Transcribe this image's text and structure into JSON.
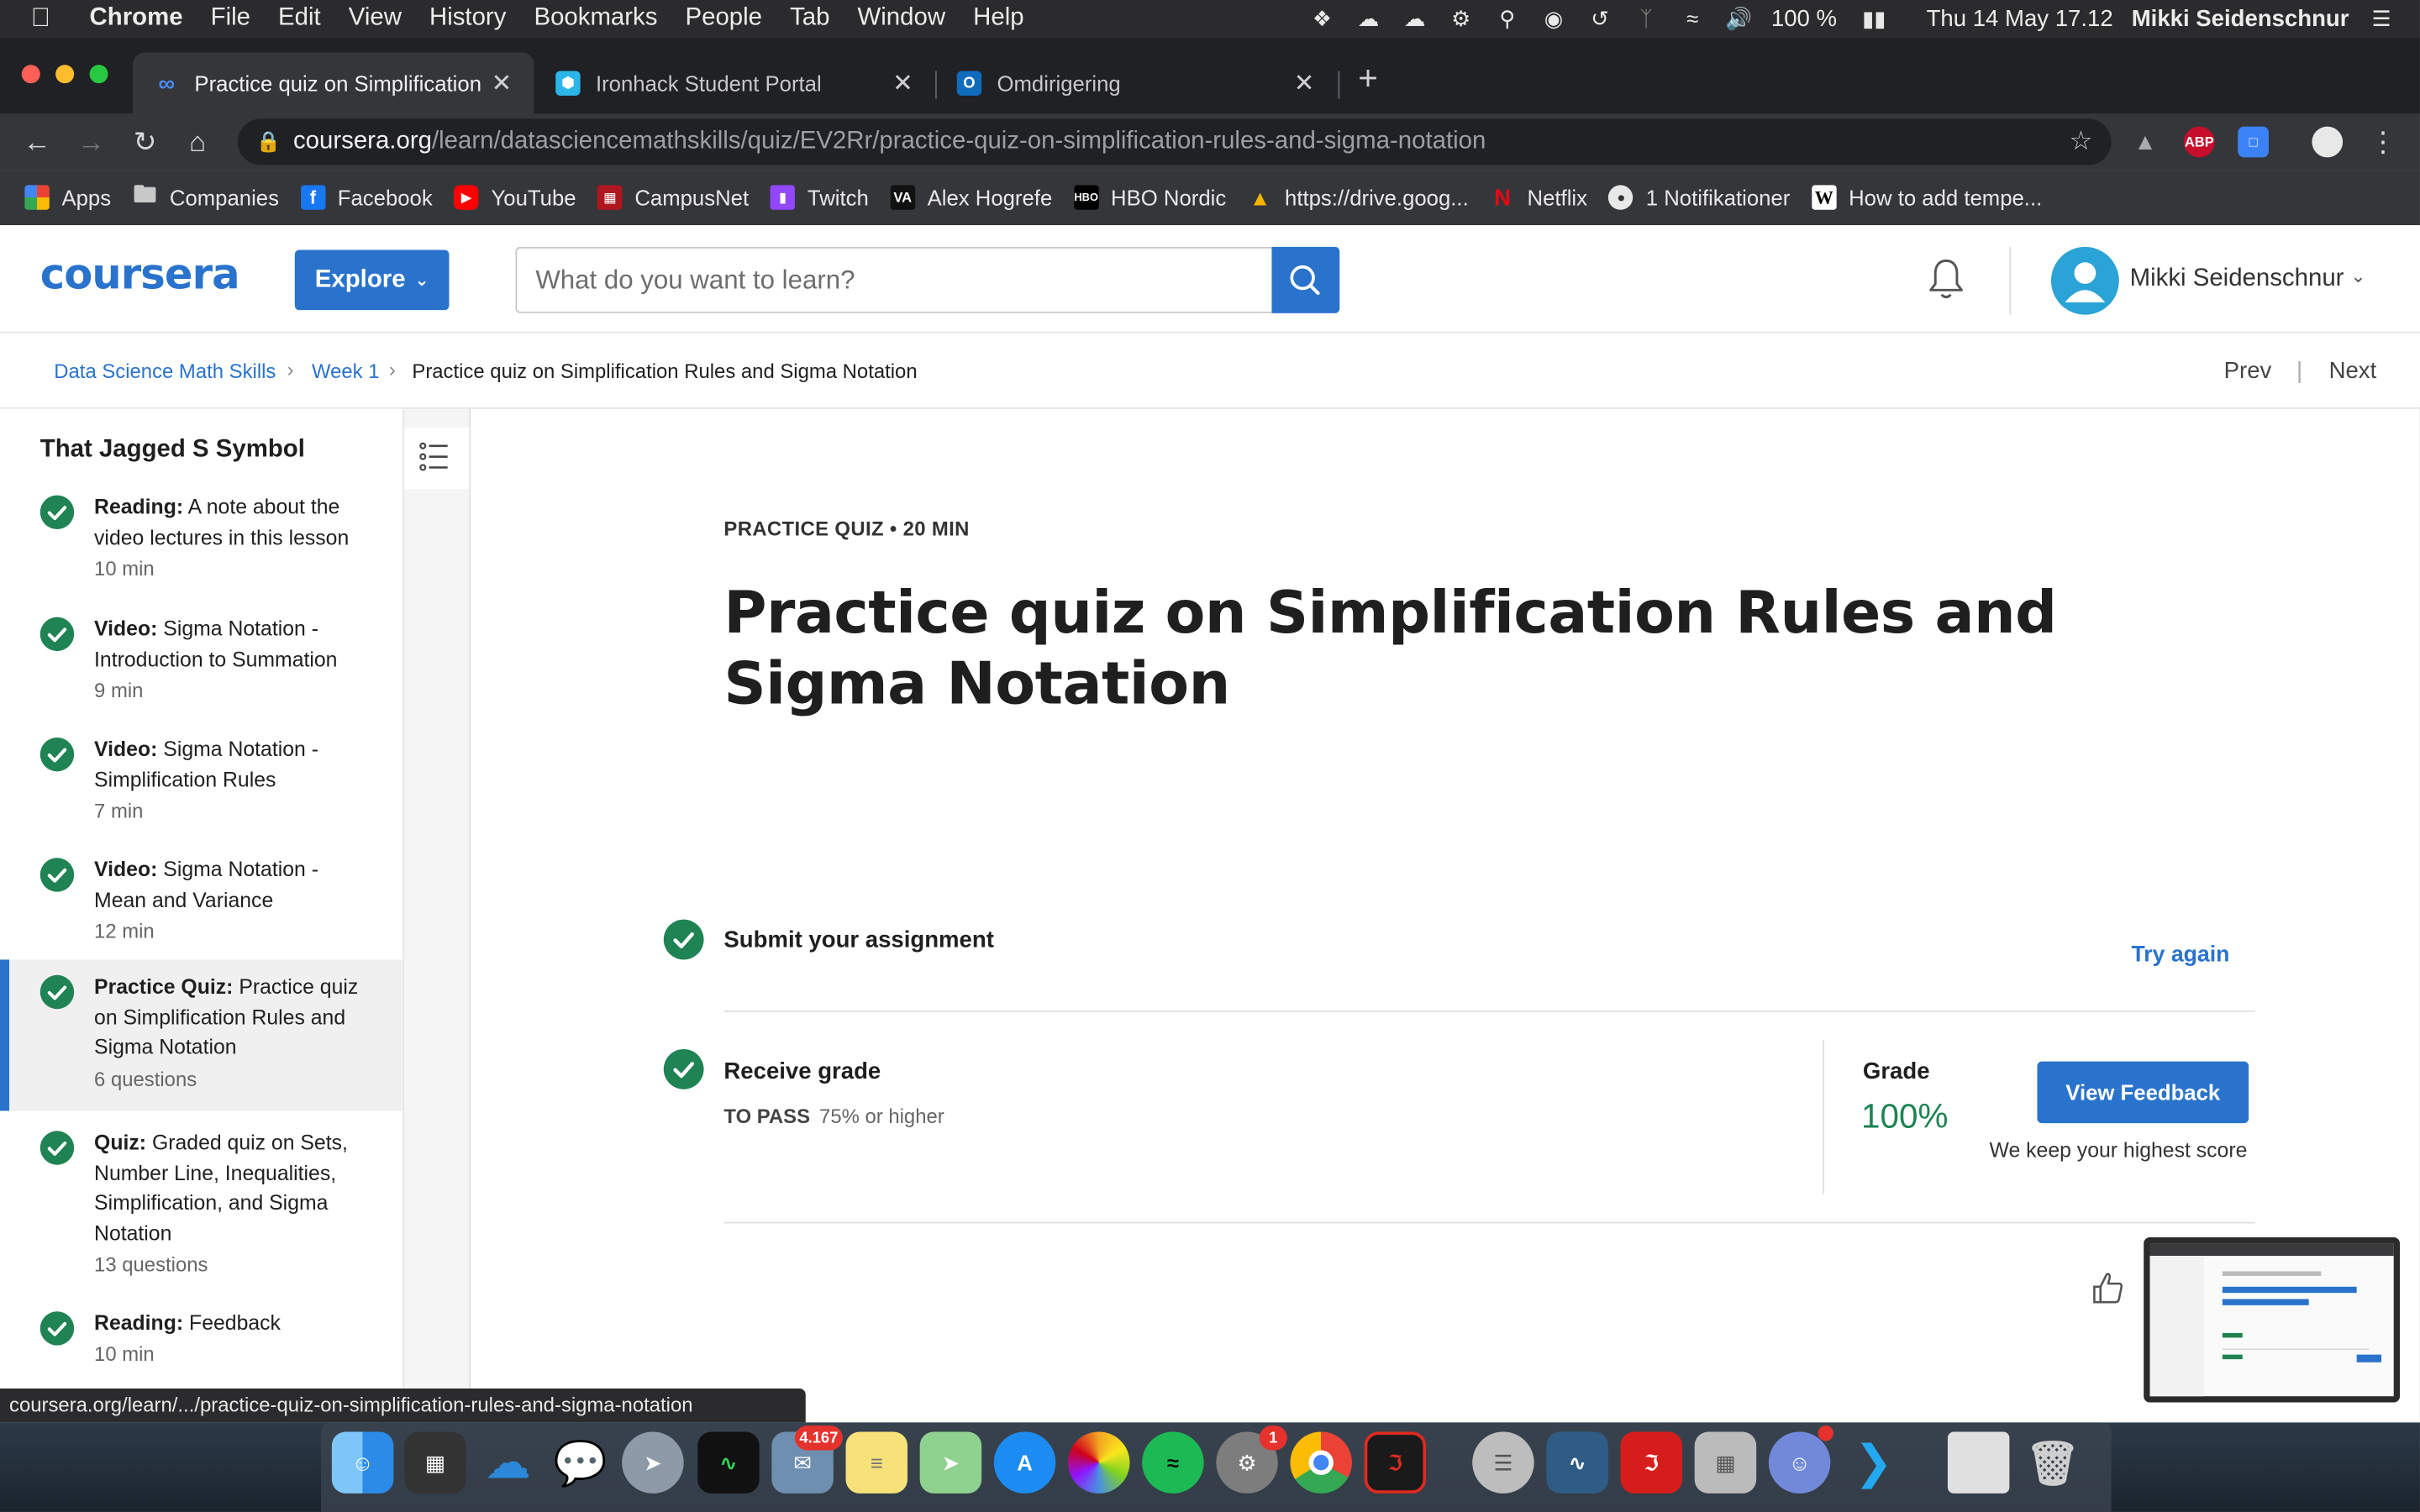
{
  "menubar": {
    "app_name": "Chrome",
    "items": [
      "File",
      "Edit",
      "View",
      "History",
      "Bookmarks",
      "People",
      "Tab",
      "Window",
      "Help"
    ],
    "battery": "100 %",
    "datetime": "Thu 14 May  17.12",
    "user": "Mikki Seidenschnur"
  },
  "tabs": [
    {
      "title": "Practice quiz on Simplification",
      "icon": "coursera-icon",
      "active": true
    },
    {
      "title": "Ironhack Student Portal",
      "icon": "ironhack-icon",
      "active": false
    },
    {
      "title": "Omdirigering",
      "icon": "outlook-icon",
      "active": false
    }
  ],
  "address_bar": {
    "host": "coursera.org",
    "path": "/learn/datasciencemathskills/quiz/EV2Rr/practice-quiz-on-simplification-rules-and-sigma-notation"
  },
  "bookmarks": [
    {
      "label": "Apps",
      "icon": "apps-grid-icon",
      "color": "#e8453c"
    },
    {
      "label": "Companies",
      "icon": "folder-icon",
      "color": "#9aa0a6"
    },
    {
      "label": "Facebook",
      "icon": "facebook-icon",
      "color": "#1877f2"
    },
    {
      "label": "YouTube",
      "icon": "youtube-icon",
      "color": "#ff0000"
    },
    {
      "label": "CampusNet",
      "icon": "campusnet-icon",
      "color": "#b0161e"
    },
    {
      "label": "Twitch",
      "icon": "twitch-icon",
      "color": "#9146ff"
    },
    {
      "label": "Alex Hogrefe",
      "icon": "va-icon",
      "color": "#111111"
    },
    {
      "label": "HBO Nordic",
      "icon": "hbo-icon",
      "color": "#000000"
    },
    {
      "label": "https://drive.goog...",
      "icon": "google-drive-icon",
      "color": "#f4b400"
    },
    {
      "label": "Netflix",
      "icon": "netflix-icon",
      "color": "#e50914"
    },
    {
      "label": "1 Notifikationer",
      "icon": "globe-icon",
      "color": "#9aa0a6"
    },
    {
      "label": "How to add tempe...",
      "icon": "wikipedia-icon",
      "color": "#ffffff"
    }
  ],
  "header": {
    "logo": "coursera",
    "explore_label": "Explore",
    "search_placeholder": "What do you want to learn?",
    "username": "Mikki Seidenschnur"
  },
  "breadcrumb": {
    "course": "Data Science Math Skills",
    "week": "Week 1",
    "current": "Practice quiz on Simplification Rules and Sigma Notation",
    "prev": "Prev",
    "next": "Next"
  },
  "sidebar": {
    "title": "That Jagged S Symbol",
    "items": [
      {
        "type": "Reading:",
        "title": "A note about the video lectures in this lesson",
        "meta": "10 min",
        "active": false
      },
      {
        "type": "Video:",
        "title": "Sigma Notation - Introduction to Summation",
        "meta": "9 min",
        "active": false
      },
      {
        "type": "Video:",
        "title": "Sigma Notation - Simplification Rules",
        "meta": "7 min",
        "active": false
      },
      {
        "type": "Video:",
        "title": "Sigma Notation - Mean and Variance",
        "meta": "12 min",
        "active": false
      },
      {
        "type": "Practice Quiz:",
        "title": "Practice quiz on Simplification Rules and Sigma Notation",
        "meta": "6 questions",
        "active": true
      },
      {
        "type": "Quiz:",
        "title": "Graded quiz on Sets, Number Line, Inequalities, Simplification, and Sigma Notation",
        "meta": "13 questions",
        "active": false
      },
      {
        "type": "Reading:",
        "title": "Feedback",
        "meta": "10 min",
        "active": false
      }
    ]
  },
  "main": {
    "kicker": "PRACTICE QUIZ • 20 MIN",
    "title": "Practice quiz on Simplification Rules and Sigma Notation",
    "submit_label": "Submit your assignment",
    "try_again": "Try again",
    "receive_label": "Receive grade",
    "to_pass_label": "TO PASS",
    "to_pass_value": "75% or higher",
    "grade_label": "Grade",
    "grade_value": "100%",
    "view_feedback": "View Feedback",
    "keep_score": "We keep your highest score"
  },
  "status_url": "coursera.org/learn/.../practice-quiz-on-simplification-rules-and-sigma-notation",
  "dock": {
    "mail_badge": "4.167",
    "prefs_badge": "1"
  },
  "colors": {
    "accent": "#2a73cc",
    "success": "#1f8354"
  }
}
